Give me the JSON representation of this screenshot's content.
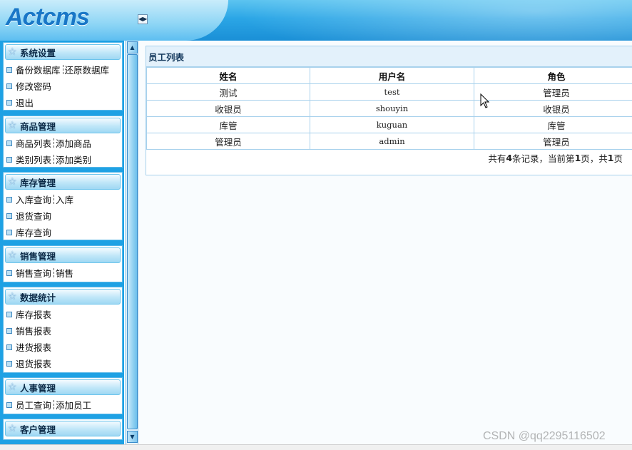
{
  "header": {
    "logo": "Actcms"
  },
  "sidebar": {
    "panels": [
      {
        "title": "系统设置",
        "rows": [
          [
            "备份数据库",
            "还原数据库"
          ],
          [
            "修改密码"
          ],
          [
            "退出"
          ]
        ]
      },
      {
        "title": "商品管理",
        "rows": [
          [
            "商品列表",
            "添加商品"
          ],
          [
            "类别列表",
            "添加类别"
          ]
        ]
      },
      {
        "title": "库存管理",
        "rows": [
          [
            "入库查询",
            "入库"
          ],
          [
            "退货查询"
          ],
          [
            "库存查询"
          ]
        ]
      },
      {
        "title": "销售管理",
        "rows": [
          [
            "销售查询",
            "销售"
          ]
        ]
      },
      {
        "title": "数据统计",
        "rows": [
          [
            "库存报表"
          ],
          [
            "销售报表"
          ],
          [
            "进货报表"
          ],
          [
            "退货报表"
          ]
        ]
      },
      {
        "title": "人事管理",
        "rows": [
          [
            "员工查询",
            "添加员工"
          ]
        ]
      },
      {
        "title": "客户管理",
        "rows": []
      }
    ]
  },
  "main": {
    "title": "员工列表",
    "columns": [
      "姓名",
      "用户名",
      "角色"
    ],
    "rows": [
      [
        "测试",
        "test",
        "管理员"
      ],
      [
        "收银员",
        "shouyin",
        "收银员"
      ],
      [
        "库管",
        "kuguan",
        "库管"
      ],
      [
        "管理员",
        "admin",
        "管理员"
      ]
    ],
    "pager": {
      "prefix": "共有 ",
      "total": "4",
      "mid1": " 条记录，当前第 ",
      "current": "1",
      "mid2": " 页，共 ",
      "pages": "1",
      "suffix": " 页"
    }
  },
  "watermark": "CSDN @qq2295116502",
  "colors": {
    "sidebar_bg": "#1ea1e4",
    "border": "#a8d1ec",
    "title_bg": "#e3f1fb"
  }
}
